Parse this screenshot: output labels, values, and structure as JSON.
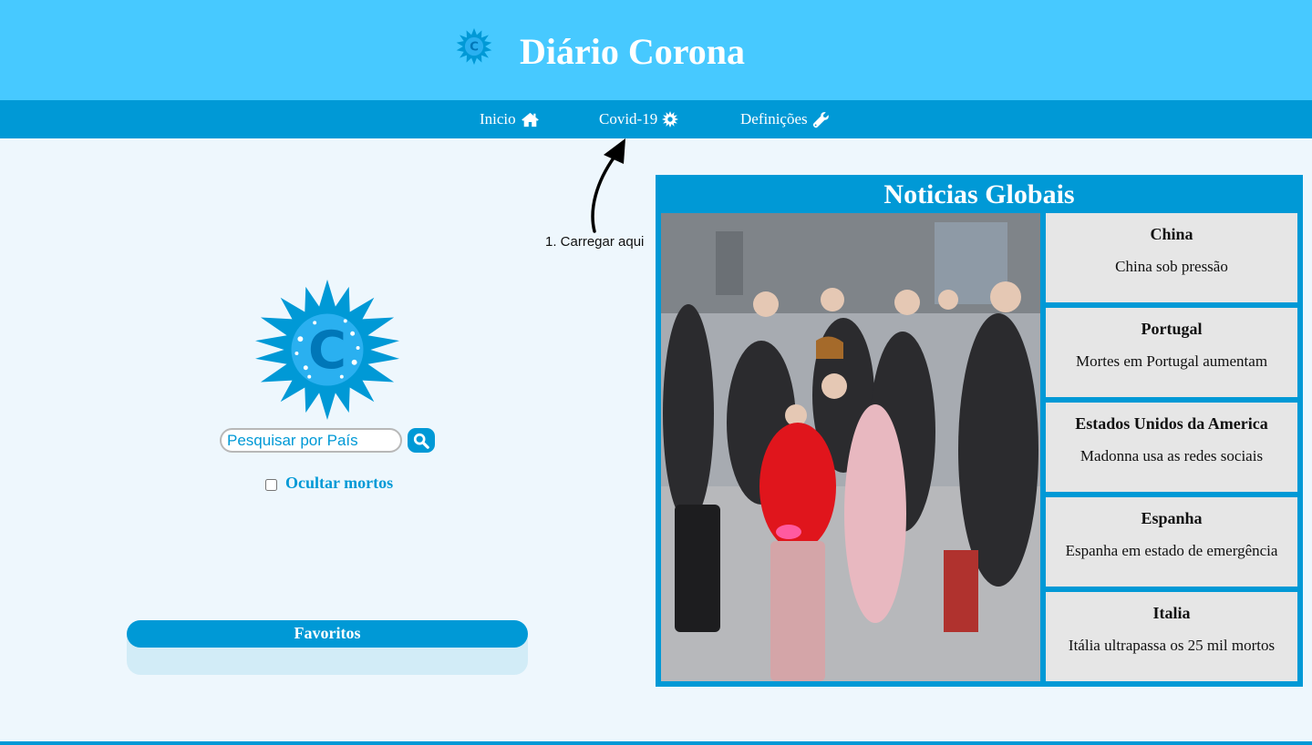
{
  "header": {
    "title": "Diário Corona",
    "logo_icon": "coronavirus-logo-icon"
  },
  "nav": {
    "items": [
      {
        "label": "Inicio",
        "icon": "home-icon"
      },
      {
        "label": "Covid-19",
        "icon": "virus-icon"
      },
      {
        "label": "Definições",
        "icon": "wrench-icon"
      }
    ]
  },
  "annotation": {
    "text": "1. Carregar aqui"
  },
  "search": {
    "placeholder": "Pesquisar por País",
    "button_icon": "search-icon"
  },
  "hide_dead": {
    "label": "Ocultar mortos",
    "checked": false
  },
  "favorites": {
    "title": "Favoritos"
  },
  "news": {
    "title": "Noticias Globais",
    "items": [
      {
        "country": "China",
        "headline": "China sob pressão"
      },
      {
        "country": "Portugal",
        "headline": "Mortes em Portugal aumentam"
      },
      {
        "country": "Estados Unidos da America",
        "headline": "Madonna usa as redes sociais"
      },
      {
        "country": "Espanha",
        "headline": "Espanha em estado de emergência"
      },
      {
        "country": "Italia",
        "headline": "Itália ultrapassa os 25 mil mortos"
      }
    ]
  },
  "colors": {
    "header_bg": "#47c9ff",
    "nav_bg": "#0099d6",
    "page_bg": "#eef7fd",
    "accent": "#0099d6",
    "card_bg": "#e6e6e6"
  }
}
